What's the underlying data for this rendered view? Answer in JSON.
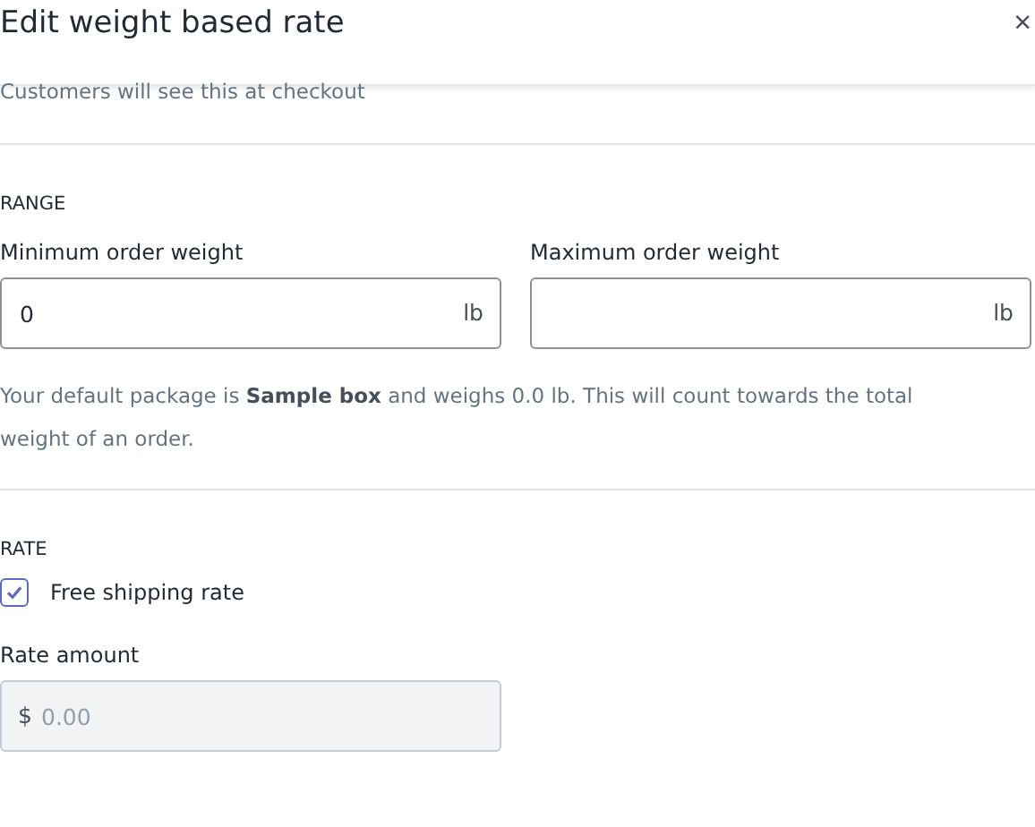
{
  "header": {
    "title": "Edit weight based rate",
    "close": "×"
  },
  "helper": "Customers will see this at checkout",
  "range": {
    "heading": "RANGE",
    "fields": [
      {
        "label": "Minimum order weight",
        "value": "0",
        "suffix": "lb"
      },
      {
        "label": "Maximum order weight",
        "suffix": "lb"
      }
    ],
    "note": "Your default package is **Sample box** and weighs 0.0 lb. This will count towards the total weight of an order."
  },
  "rate": {
    "heading": "RATE",
    "free_shipping": {
      "label": "Free shipping rate",
      "checked": true
    },
    "amount": {
      "label": "Rate amount",
      "prefix": "$",
      "placeholder": "0.00",
      "disabled": true
    }
  }
}
